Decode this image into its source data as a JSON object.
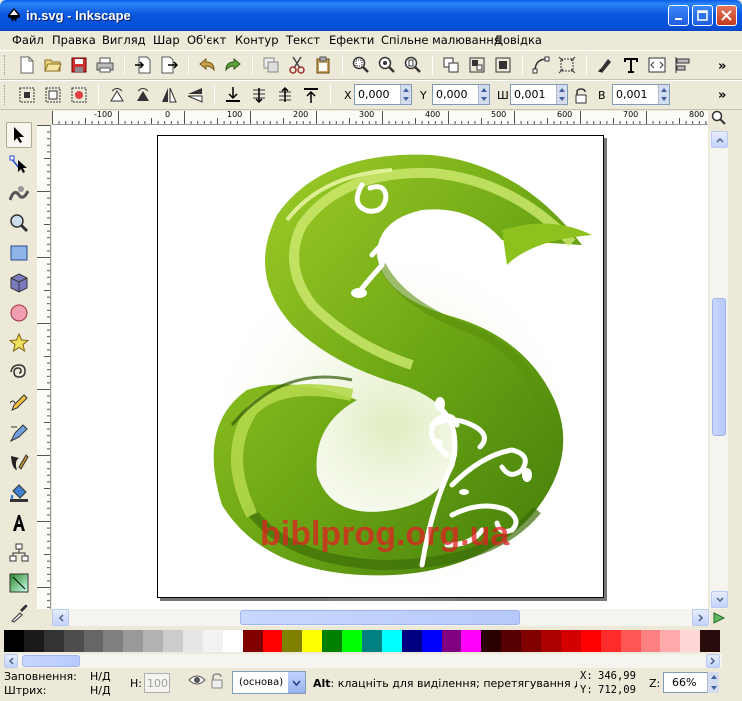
{
  "window": {
    "title": "in.svg - Inkscape"
  },
  "menu": [
    "Файл",
    "Правка",
    "Вигляд",
    "Шар",
    "Об'єкт",
    "Контур",
    "Текст",
    "Ефекти",
    "Спільне малювання",
    "Довідка"
  ],
  "toolbar_main": {
    "icons": [
      "new-doc-icon",
      "open-icon",
      "save-icon",
      "print-icon",
      "import-icon",
      "export-icon",
      "undo-icon",
      "redo-icon",
      "duplicate-icon",
      "cut-icon",
      "paste-icon",
      "zoom-selection-icon",
      "zoom-drawing-icon",
      "zoom-page-icon",
      "group-icon",
      "ungroup-icon",
      "clone-icon",
      "node-edit-icon",
      "fill-stroke-icon",
      "text-editor-icon",
      "xml-editor-icon",
      "align-icon"
    ],
    "overflow": "»"
  },
  "toolbar_select": {
    "x_label": "X",
    "x_value": "0,000",
    "y_label": "Y",
    "y_value": "0,000",
    "w_label": "Ш",
    "w_value": "0,001",
    "h_label": "В",
    "h_value": "0,001",
    "overflow": "»"
  },
  "ruler": {
    "h_ticks": [
      "-100",
      "0",
      "100",
      "200",
      "300",
      "400",
      "500",
      "600",
      "700",
      "800"
    ],
    "v_ticks": [
      "0",
      "100",
      "200",
      "300",
      "400",
      "500",
      "600",
      "700",
      "800"
    ]
  },
  "canvas": {
    "watermark": "biblprog.org.ua"
  },
  "palette": [
    "#000000",
    "#1a1a1a",
    "#333333",
    "#4d4d4d",
    "#666666",
    "#808080",
    "#999999",
    "#b3b3b3",
    "#cccccc",
    "#e6e6e6",
    "#f2f2f2",
    "#ffffff",
    "#800000",
    "#ff0000",
    "#808000",
    "#ffff00",
    "#008000",
    "#00ff00",
    "#008080",
    "#00ffff",
    "#000080",
    "#0000ff",
    "#800080",
    "#ff00ff",
    "#2b0000",
    "#550000",
    "#800000",
    "#aa0000",
    "#d40000",
    "#ff0000",
    "#ff2a2a",
    "#ff5555",
    "#ff8080",
    "#ffaaaa",
    "#ffd5d5",
    "#280b0b"
  ],
  "status": {
    "fill_label": "Заповнення:",
    "fill_value": "Н/Д",
    "stroke_label": "Штрих:",
    "stroke_value": "Н/Д",
    "h_label": "Н:",
    "h_value": "100",
    "layer": "(основа)",
    "message_bold": "Alt",
    "message": ": клацніть для виділення; перетягування для пе",
    "x_label": "X:",
    "x_value": "346,99",
    "y_label": "Y:",
    "y_value": "712,09",
    "zoom_label": "Z:",
    "zoom_value": "66%"
  }
}
